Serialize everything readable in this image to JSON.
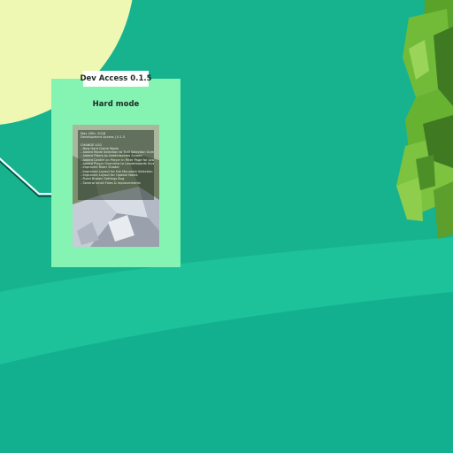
{
  "level_card": {
    "version_tag": "Dev Access 0.1.5",
    "title": "Hard mode",
    "changelog": {
      "date": "May 20th, 2018",
      "build": "Development Access | 0.1.5",
      "heading": "CHANGE LOG",
      "items": [
        "- New Hard Game Mode",
        "- Added Mode Selection to Trail Selection Screen",
        "- Added Filters to Leaderboards Screen",
        "- Added Center on Player in Filter Page for Leaderboards Screen",
        "- Added Player Overview to Leaderboards Screen",
        "- Improved Rider Shader",
        "- Improved Layout for the Mountain Selection",
        "- Improved Layout for Update Notes",
        "- Fixed Broken Settings Bug",
        "- Several small Fixes & Improvements"
      ]
    }
  },
  "colors": {
    "background": "#17b38f",
    "card": "#85f4b2",
    "sun": "#eff8b2",
    "tree": "#6fb52f",
    "tag": "#ffffff"
  },
  "icons": [
    "sun-icon",
    "tree-icon",
    "trail-path-icon"
  ]
}
